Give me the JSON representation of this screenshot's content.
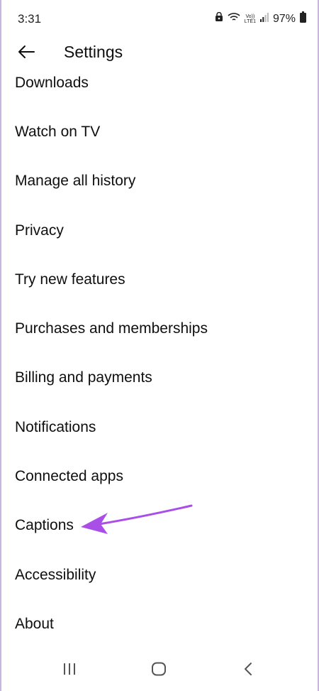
{
  "status_bar": {
    "time": "3:31",
    "network_label_top": "Vo))",
    "network_label_bottom": "LTE1",
    "battery": "97%"
  },
  "header": {
    "title": "Settings",
    "back_icon": "arrow-left-icon"
  },
  "settings_items": [
    {
      "label": "Downloads"
    },
    {
      "label": "Watch on TV"
    },
    {
      "label": "Manage all history"
    },
    {
      "label": "Privacy"
    },
    {
      "label": "Try new features"
    },
    {
      "label": "Purchases and memberships"
    },
    {
      "label": "Billing and payments"
    },
    {
      "label": "Notifications"
    },
    {
      "label": "Connected apps"
    },
    {
      "label": "Captions"
    },
    {
      "label": "Accessibility"
    },
    {
      "label": "About"
    }
  ],
  "annotation": {
    "color": "#a94ee6",
    "points_to": "Captions"
  },
  "nav_bar": {
    "icons": [
      "recent-apps-icon",
      "home-icon",
      "back-icon"
    ]
  }
}
